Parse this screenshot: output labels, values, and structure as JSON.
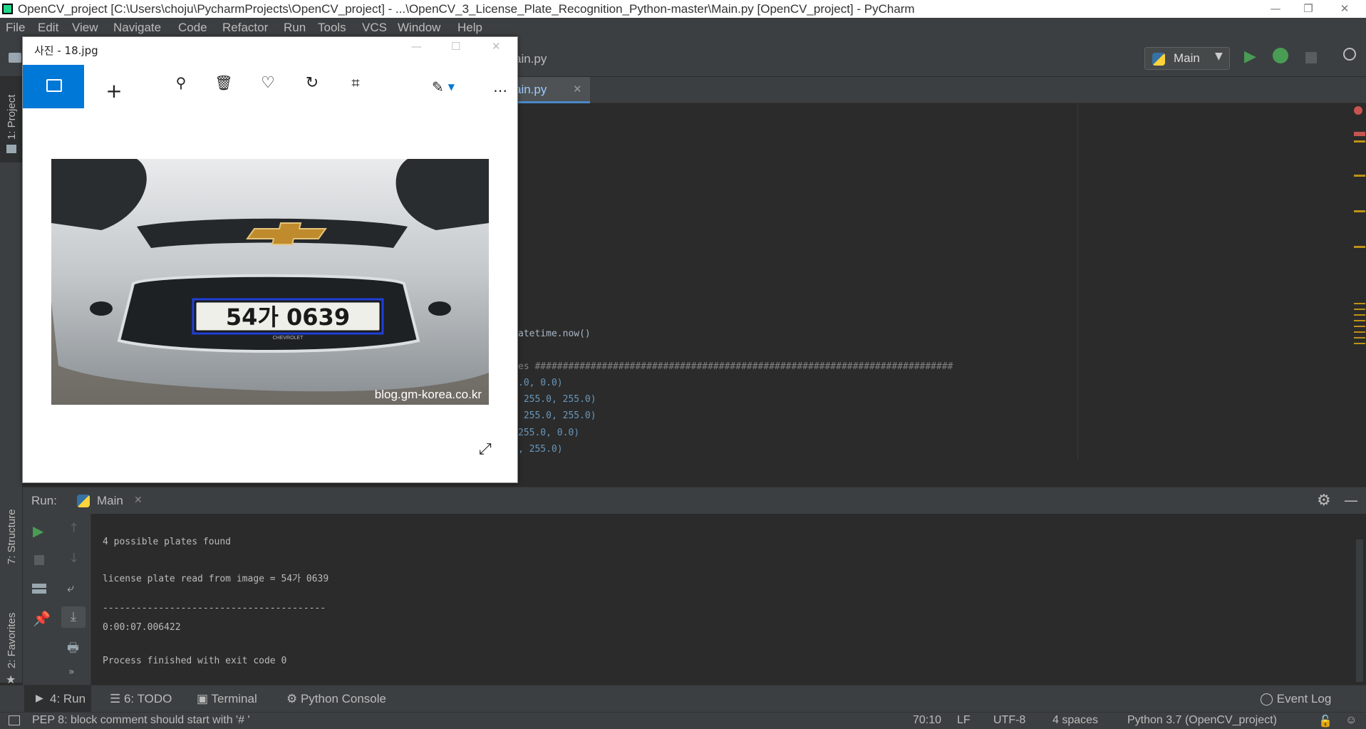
{
  "window": {
    "title": "OpenCV_project [C:\\Users\\choju\\PycharmProjects\\OpenCV_project] - ...\\OpenCV_3_License_Plate_Recognition_Python-master\\Main.py [OpenCV_project] - PyCharm"
  },
  "menu": [
    "File",
    "Edit",
    "View",
    "Navigate",
    "Code",
    "Refactor",
    "Run",
    "Tools",
    "VCS",
    "Window",
    "Help"
  ],
  "toolbar": {
    "run_config": "Main",
    "breadcrumb_tail": "ain.py",
    "editor_tab_tail": "ain.py"
  },
  "sidebar": {
    "project": "1: Project",
    "structure": "7: Structure",
    "favorites": "2: Favorites"
  },
  "editor": {
    "lines": [
      {
        "t": "atetime.now()"
      },
      {
        "t": "es ###########################################################################"
      },
      {
        "t": ".0, 0.0)"
      },
      {
        "t": " 255.0, 255.0)"
      },
      {
        "t": " 255.0, 255.0)"
      },
      {
        "t": "255.0, 0.0)"
      },
      {
        "t": ", 255.0)"
      }
    ]
  },
  "photo_viewer": {
    "title": "사진 - 18.jpg",
    "plate_text": "54가 0639",
    "watermark": "blog.gm-korea.co.kr",
    "plate_maker": "CHEVROLET"
  },
  "run_panel": {
    "label": "Run:",
    "tab": "Main",
    "output": [
      "4 possible plates found",
      "license plate read from image = 54가 0639",
      "----------------------------------------",
      "0:00:07.006422",
      "Process finished with exit code 0"
    ]
  },
  "bottom_tabs": {
    "run": "4: Run",
    "todo": "6: TODO",
    "terminal": "Terminal",
    "python_console": "Python Console",
    "event_log": "Event Log"
  },
  "status": {
    "message": "PEP 8: block comment should start with '# '",
    "position": "70:10",
    "line_sep": "LF",
    "encoding": "UTF-8",
    "indent": "4 spaces",
    "interpreter": "Python 3.7 (OpenCV_project)"
  },
  "colors": {
    "accent": "#0078d7",
    "run_green": "#499c54",
    "ide_bg": "#2b2b2b",
    "panel_bg": "#3c3f41"
  }
}
